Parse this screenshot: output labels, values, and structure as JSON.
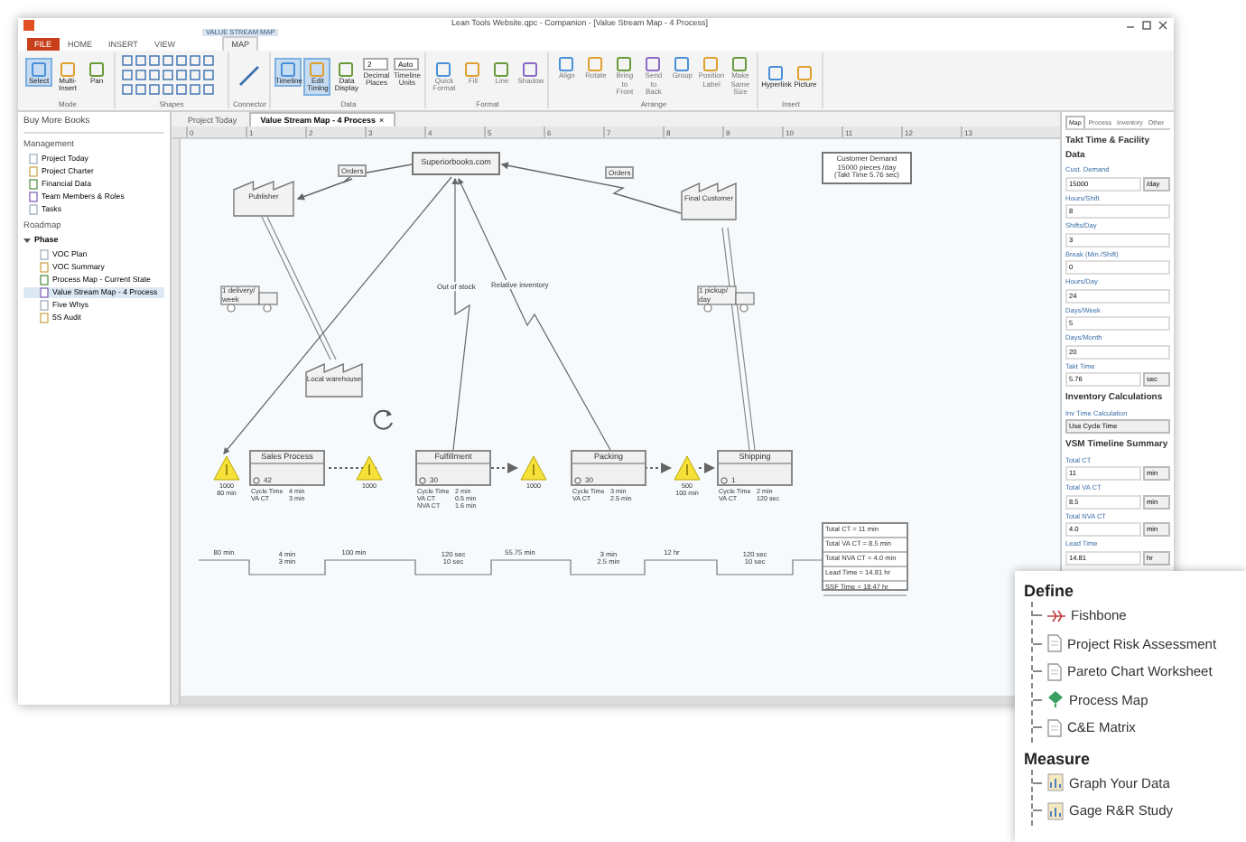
{
  "window": {
    "title": "Lean Tools Website.qpc - Companion - [Value Stream Map - 4 Process]"
  },
  "ribbon": {
    "context_label": "VALUE STREAM MAP",
    "tabs": [
      {
        "label": "FILE",
        "selected": false,
        "kind": "file"
      },
      {
        "label": "HOME",
        "selected": false,
        "kind": "plain"
      },
      {
        "label": "INSERT",
        "selected": false,
        "kind": "plain"
      },
      {
        "label": "VIEW",
        "selected": false,
        "kind": "plain"
      },
      {
        "label": "MAP",
        "selected": true,
        "kind": "context"
      }
    ],
    "groups": [
      {
        "label": "Mode",
        "kind": "buttons",
        "buttons": [
          {
            "label": "Select",
            "selected": true,
            "disabled": false
          },
          {
            "label": "Multi-Insert",
            "selected": false,
            "disabled": false
          },
          {
            "label": "Pan",
            "selected": false,
            "disabled": false
          }
        ]
      },
      {
        "label": "Shapes",
        "kind": "shapes"
      },
      {
        "label": "Connector",
        "kind": "connector"
      },
      {
        "label": "Data",
        "kind": "buttons",
        "buttons": [
          {
            "label": "Timeline",
            "selected": true,
            "disabled": false
          },
          {
            "label": "Edit Timing",
            "selected": true,
            "disabled": false
          },
          {
            "label": "Data Display",
            "selected": false,
            "disabled": false
          }
        ],
        "fields": [
          {
            "label": "Decimal Places",
            "value": "2"
          },
          {
            "label": "Timeline Units",
            "value": "Auto"
          }
        ]
      },
      {
        "label": "Format",
        "kind": "buttons",
        "buttons": [
          {
            "label": "Quick Format",
            "selected": false,
            "disabled": true
          },
          {
            "label": "Fill",
            "selected": false,
            "disabled": true
          },
          {
            "label": "Line",
            "selected": false,
            "disabled": true
          },
          {
            "label": "Shadow",
            "selected": false,
            "disabled": true
          }
        ]
      },
      {
        "label": "Arrange",
        "kind": "buttons",
        "buttons": [
          {
            "label": "Align",
            "selected": false,
            "disabled": true
          },
          {
            "label": "Rotate",
            "selected": false,
            "disabled": true
          },
          {
            "label": "Bring to Front",
            "selected": false,
            "disabled": true
          },
          {
            "label": "Send to Back",
            "selected": false,
            "disabled": true
          },
          {
            "label": "Group",
            "selected": false,
            "disabled": true
          },
          {
            "label": "Position Label",
            "selected": false,
            "disabled": true
          },
          {
            "label": "Make Same Size",
            "selected": false,
            "disabled": true
          }
        ]
      },
      {
        "label": "Insert",
        "kind": "buttons",
        "buttons": [
          {
            "label": "Hyperlink",
            "selected": false,
            "disabled": false
          },
          {
            "label": "Picture",
            "selected": false,
            "disabled": false
          }
        ]
      }
    ]
  },
  "sidebar": {
    "header": "Buy More Books",
    "sections": [
      {
        "title": "Management",
        "items": [
          {
            "label": "Project Today",
            "selected": false
          },
          {
            "label": "Project Charter",
            "selected": false
          },
          {
            "label": "Financial Data",
            "selected": false
          },
          {
            "label": "Team Members & Roles",
            "selected": false
          },
          {
            "label": "Tasks",
            "selected": false
          }
        ]
      },
      {
        "title": "Roadmap",
        "groups": [
          {
            "label": "Phase",
            "expanded": true,
            "children": [
              {
                "label": "VOC Plan",
                "selected": false
              },
              {
                "label": "VOC Summary",
                "selected": false
              },
              {
                "label": "Process Map - Current State",
                "selected": false
              },
              {
                "label": "Value Stream Map - 4 Process",
                "selected": true
              },
              {
                "label": "Five Whys",
                "selected": false
              },
              {
                "label": "5S Audit",
                "selected": false
              }
            ]
          }
        ]
      }
    ]
  },
  "doc_tabs": [
    {
      "label": "Project Today",
      "selected": false
    },
    {
      "label": "Value Stream Map - 4 Process",
      "selected": true,
      "close": "×"
    }
  ],
  "ruler": [
    "0",
    "1",
    "2",
    "3",
    "4",
    "5",
    "6",
    "7",
    "8",
    "9",
    "10",
    "11",
    "12",
    "13"
  ],
  "map": {
    "entities": [
      {
        "kind": "company",
        "label": "Superiorbooks.com"
      },
      {
        "kind": "factory",
        "label": "Publisher"
      },
      {
        "kind": "factory",
        "label": "Final Customer"
      },
      {
        "kind": "factory",
        "label": "Local warehouse"
      },
      {
        "kind": "truck",
        "label": "1 delivery/ week"
      },
      {
        "kind": "truck",
        "label": "1 pickup/ day"
      }
    ],
    "flow_labels": [
      "Orders",
      "Orders",
      "Out of stock",
      "Relative inventory"
    ],
    "customer_demand": [
      "Customer Demand",
      "15000 pieces /day",
      "(Takt Time 5.76 sec)"
    ],
    "inventory": [
      {
        "lines": [
          "1000",
          "80 min"
        ]
      },
      {
        "lines": [
          "1000"
        ]
      },
      {
        "lines": [
          "1000"
        ]
      },
      {
        "lines": [
          "500",
          "100 min"
        ]
      }
    ],
    "processes": [
      {
        "name": "Sales Process",
        "operators": "42",
        "data": [
          [
            "Cycle Time",
            "4 min"
          ],
          [
            "VA CT",
            "3 min"
          ]
        ]
      },
      {
        "name": "Fulfillment",
        "operators": "30",
        "data": [
          [
            "Cycle Time",
            "2 min"
          ],
          [
            "VA CT",
            "0.5 min"
          ],
          [
            "NVA CT",
            "1.6 min"
          ]
        ]
      },
      {
        "name": "Packing",
        "operators": "30",
        "data": [
          [
            "Cycle Time",
            "3 min"
          ],
          [
            "VA CT",
            "2.5 min"
          ]
        ]
      },
      {
        "name": "Shipping",
        "operators": "1",
        "data": [
          [
            "Cycle Time",
            "2 min"
          ],
          [
            "VA CT",
            "120 sec"
          ]
        ]
      }
    ],
    "timeline": [
      {
        "wait": "80 min",
        "process": [
          "4 min",
          "3 min"
        ]
      },
      {
        "wait": "100 min",
        "process": [
          "120 sec",
          "10 sec"
        ]
      },
      {
        "wait": "55.75 min",
        "process": [
          "3 min",
          "2.5 min"
        ]
      },
      {
        "wait": "12 hr",
        "process": [
          "120 sec",
          "10 sec"
        ]
      }
    ],
    "summary": [
      "Total CT = 11 min",
      "Total VA CT = 8.5 min",
      "Total NVA CT = 4.0 min",
      "Lead Time = 14.81 hr",
      "SSF Time = 18.47 hr"
    ]
  },
  "panel": {
    "tabs": [
      {
        "label": "Map",
        "selected": true
      },
      {
        "label": "Process",
        "selected": false
      },
      {
        "label": "Inventory",
        "selected": false
      },
      {
        "label": "Other",
        "selected": false
      }
    ],
    "sections": [
      {
        "title": "Takt Time & Facility Data",
        "fields": [
          {
            "label": "Cust. Demand",
            "value": "15000",
            "unit": "/day"
          },
          {
            "label": "Hours/Shift",
            "value": "8"
          },
          {
            "label": "Shifts/Day",
            "value": "3"
          },
          {
            "label": "Break (Min./Shift)",
            "value": "0"
          },
          {
            "label": "Hours/Day",
            "value": "24"
          },
          {
            "label": "Days/Week",
            "value": "5"
          },
          {
            "label": "Days/Month",
            "value": "20"
          },
          {
            "label": "Takt Time",
            "value": "5.76",
            "unit": "sec"
          }
        ]
      },
      {
        "title": "Inventory Calculations",
        "fields": [
          {
            "label": "Inv Time Calculation",
            "value": "Use Cycle Time",
            "kind": "select"
          }
        ]
      },
      {
        "title": "VSM Timeline Summary",
        "fields": [
          {
            "label": "Total CT",
            "value": "11",
            "unit": "min"
          },
          {
            "label": "Total VA CT",
            "value": "8.5",
            "unit": "min"
          },
          {
            "label": "Total NVA CT",
            "value": "4.0",
            "unit": "min"
          },
          {
            "label": "Lead Time",
            "value": "14.81",
            "unit": "hr"
          }
        ]
      }
    ]
  },
  "popup": {
    "groups": [
      {
        "title": "Define",
        "items": [
          {
            "label": "Fishbone",
            "kind": "fishbone"
          },
          {
            "label": "Project Risk Assessment",
            "kind": "doc"
          },
          {
            "label": "Pareto Chart Worksheet",
            "kind": "doc"
          },
          {
            "label": "Process Map",
            "kind": "map"
          },
          {
            "label": "C&E Matrix",
            "kind": "doc"
          }
        ]
      },
      {
        "title": "Measure",
        "items": [
          {
            "label": "Graph Your Data",
            "kind": "chart"
          },
          {
            "label": "Gage R&R Study",
            "kind": "chart"
          }
        ]
      }
    ]
  }
}
